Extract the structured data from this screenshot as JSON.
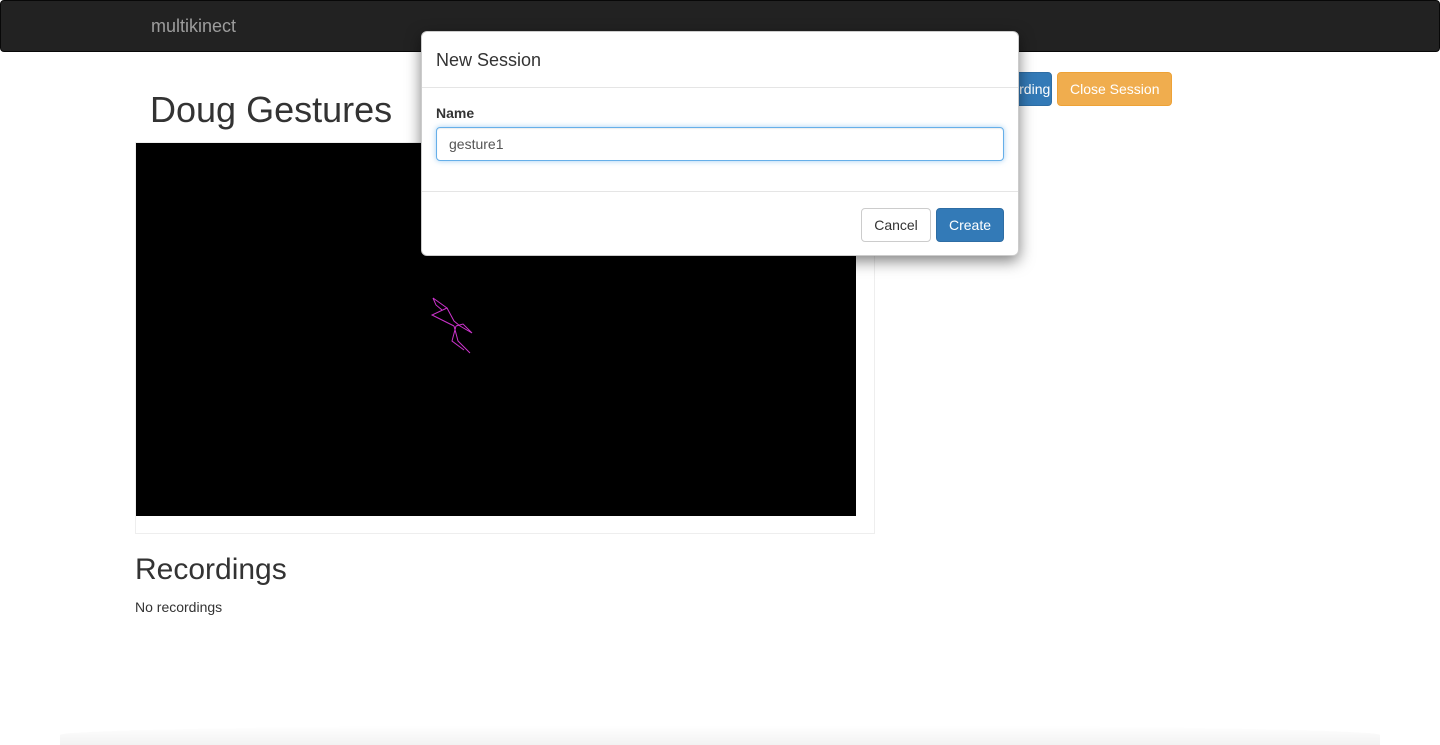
{
  "navbar": {
    "brand": "multikinect"
  },
  "page": {
    "title": "Doug Gestures",
    "start_button_label": "Start Recording",
    "close_session_label": "Close Session"
  },
  "recordings": {
    "title": "Recordings",
    "empty_text": "No recordings"
  },
  "skeleton": {
    "color": "#cc33cc"
  },
  "modal": {
    "title": "New Session",
    "name_label": "Name",
    "name_value": "gesture1",
    "cancel_label": "Cancel",
    "create_label": "Create"
  },
  "colors": {
    "primary": "#337ab7",
    "warning": "#f0ad4e",
    "navbar": "#222222"
  }
}
